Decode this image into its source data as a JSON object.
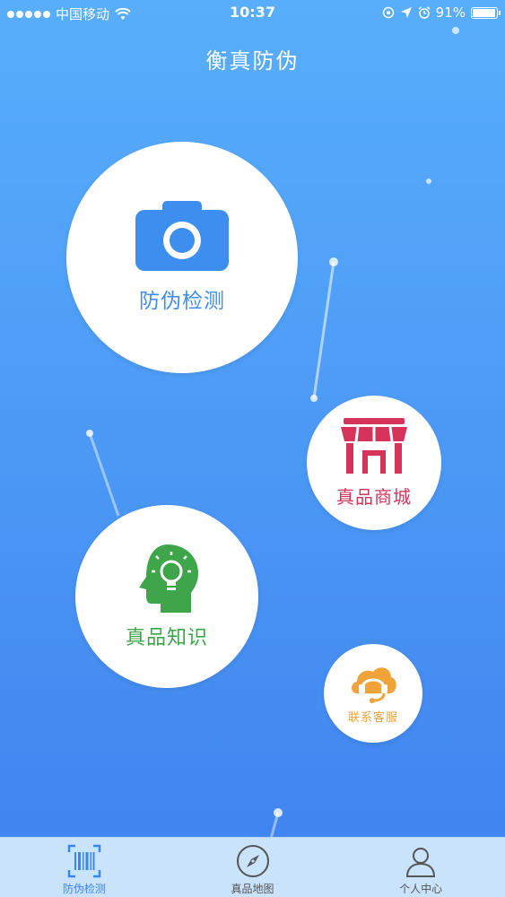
{
  "status_bar": {
    "carrier": "中国移动",
    "time": "10:37",
    "battery": "91%",
    "battery_level": 0.91,
    "signal_icon": "signal-dots-icon",
    "wifi_icon": "wifi-icon"
  },
  "nav": {
    "title": "衡真防伪"
  },
  "features": {
    "detect": {
      "label": "防伪检测",
      "icon": "camera-icon",
      "color": "#3e8ef0"
    },
    "mall": {
      "label": "真品商城",
      "icon": "storefront-icon",
      "color": "#d6335b"
    },
    "knowledge": {
      "label": "真品知识",
      "icon": "head-lightbulb-icon",
      "color": "#3fa54b"
    },
    "service": {
      "label": "联系客服",
      "icon": "headset-cloud-icon",
      "color": "#f0a23b"
    }
  },
  "tabbar": {
    "tabs": [
      {
        "label": "防伪检测",
        "icon": "barcode-scan-icon",
        "active": true
      },
      {
        "label": "真品地图",
        "icon": "compass-icon",
        "active": false
      },
      {
        "label": "个人中心",
        "icon": "person-icon",
        "active": false
      }
    ]
  },
  "colors": {
    "background_top": "#58aefb",
    "background_bottom": "#3f82ef",
    "tabbar": "#c9e3fb",
    "accent": "#3a86f0"
  }
}
